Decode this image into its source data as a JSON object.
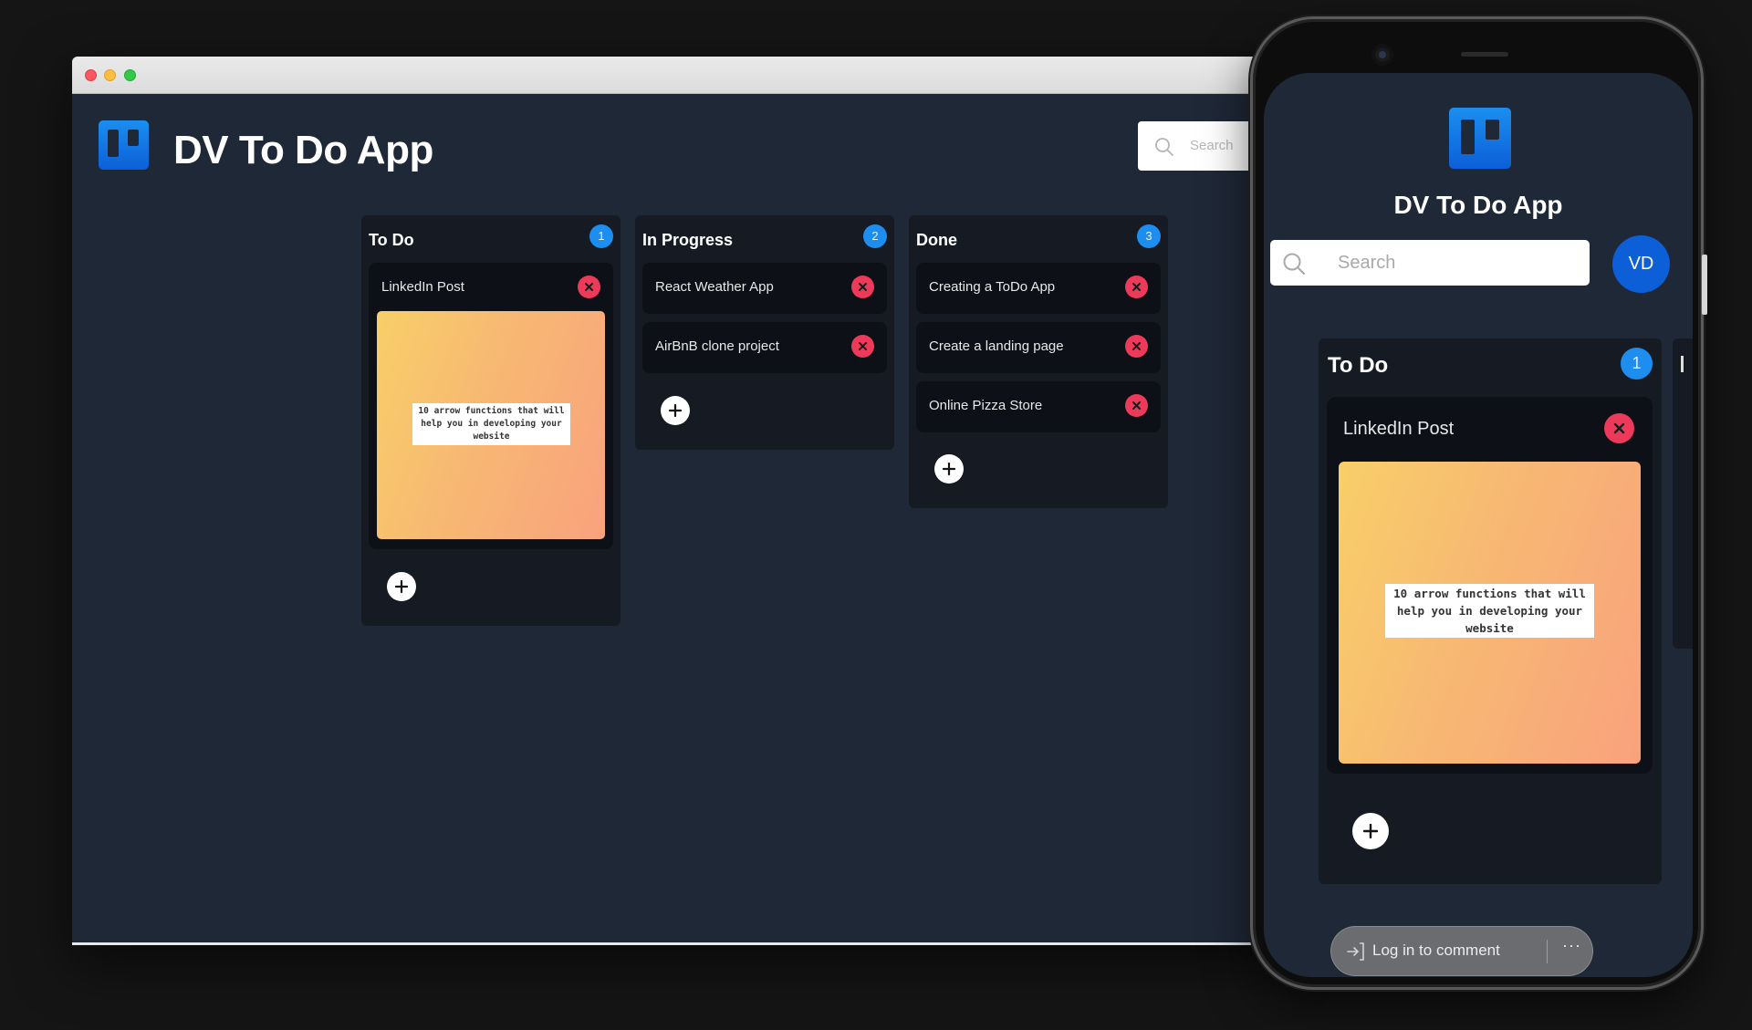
{
  "app": {
    "title": "DV To Do App"
  },
  "desktop": {
    "search": {
      "placeholder": "Search"
    },
    "columns": [
      {
        "title": "To Do",
        "count": "1",
        "cards": [
          {
            "title": "LinkedIn Post",
            "image_caption": "10 arrow functions that will help you in developing your website"
          }
        ]
      },
      {
        "title": "In Progress",
        "count": "2",
        "cards": [
          {
            "title": "React Weather App"
          },
          {
            "title": "AirBnB clone project"
          }
        ]
      },
      {
        "title": "Done",
        "count": "3",
        "cards": [
          {
            "title": "Creating a ToDo App"
          },
          {
            "title": "Create a landing page"
          },
          {
            "title": "Online Pizza Store"
          }
        ]
      }
    ]
  },
  "mobile": {
    "search": {
      "placeholder": "Search"
    },
    "avatar_initials": "VD",
    "column": {
      "title": "To Do",
      "count": "1",
      "card": {
        "title": "LinkedIn Post",
        "image_caption": "10 arrow functions that will help you in developing your website"
      }
    },
    "comment_bar": {
      "label": "Log in to comment",
      "more": "···"
    }
  },
  "colors": {
    "background": "#151515",
    "app_bg": "#1f2837",
    "column_bg": "#161b23",
    "card_bg": "#0d1017",
    "badge": "#1d8ef0",
    "delete": "#ee3a5a",
    "brand_blue": "#0c5fd7"
  },
  "icons": {
    "logo": "kanban-board-icon",
    "search": "search-icon",
    "delete": "close-icon",
    "add": "plus-icon",
    "login": "login-arrow-icon",
    "more": "ellipsis-icon"
  }
}
